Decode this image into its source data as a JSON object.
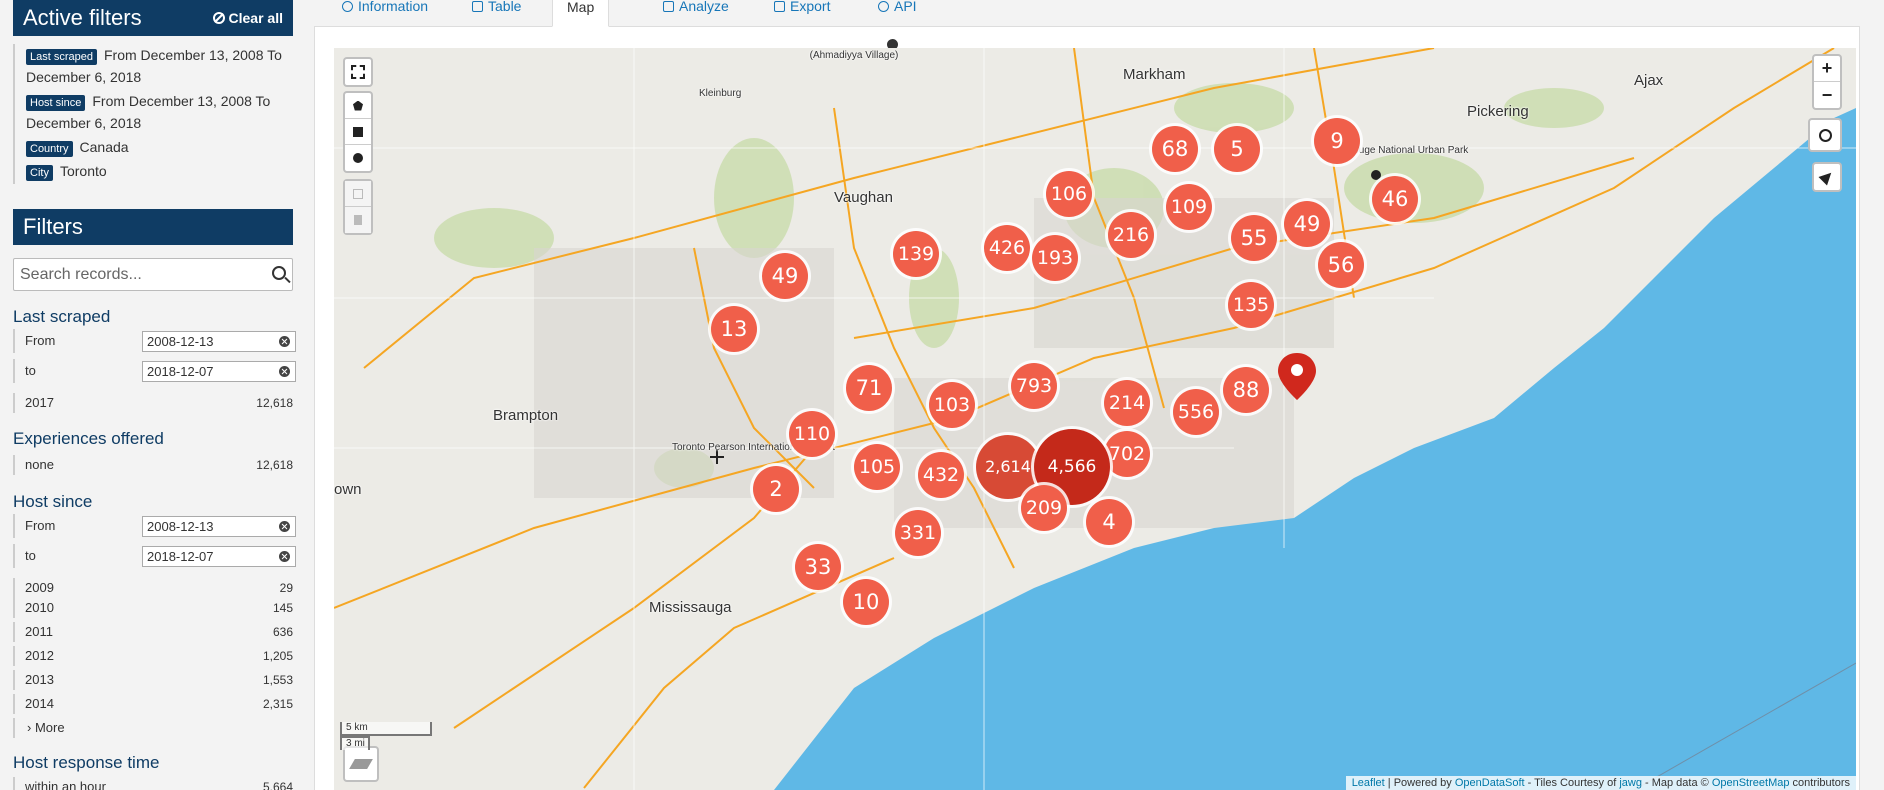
{
  "sidebar": {
    "active_filters": {
      "title": "Active filters",
      "clear_label": "Clear all",
      "items": [
        {
          "tag": "Last scraped",
          "text": "From December 13, 2008 To December 6, 2018"
        },
        {
          "tag": "Host since",
          "text": "From December 13, 2008 To December 6, 2018"
        },
        {
          "tag": "Country",
          "text": "Canada"
        },
        {
          "tag": "City",
          "text": "Toronto"
        }
      ]
    },
    "filters": {
      "title": "Filters",
      "search_placeholder": "Search records...",
      "last_scraped": {
        "title": "Last scraped",
        "from_label": "From",
        "from_value": "2008-12-13",
        "to_label": "to",
        "to_value": "2018-12-07",
        "rows": [
          {
            "label": "2017",
            "count": "12,618"
          }
        ]
      },
      "experiences": {
        "title": "Experiences offered",
        "rows": [
          {
            "label": "none",
            "count": "12,618"
          }
        ]
      },
      "host_since": {
        "title": "Host since",
        "from_label": "From",
        "from_value": "2008-12-13",
        "to_label": "to",
        "to_value": "2018-12-07",
        "rows": [
          {
            "label": "2009",
            "count": "29"
          },
          {
            "label": "2010",
            "count": "145"
          },
          {
            "label": "2011",
            "count": "636"
          },
          {
            "label": "2012",
            "count": "1,205"
          },
          {
            "label": "2013",
            "count": "1,553"
          },
          {
            "label": "2014",
            "count": "2,315"
          }
        ],
        "more_label": "› More"
      },
      "host_response_time": {
        "title": "Host response time",
        "rows": [
          {
            "label": "within an hour",
            "count": "5,664"
          }
        ]
      }
    }
  },
  "tabs": [
    {
      "label": "Information",
      "icon": "info-icon"
    },
    {
      "label": "Table",
      "icon": "table-icon"
    },
    {
      "label": "Map",
      "icon": "globe-icon",
      "active": true
    },
    {
      "label": "Analyze",
      "icon": "chart-icon"
    },
    {
      "label": "Export",
      "icon": "download-icon"
    },
    {
      "label": "API",
      "icon": "cogs-icon"
    }
  ],
  "map": {
    "places": [
      "Markham",
      "Ajax",
      "Pickering",
      "Vaughan",
      "Kleinburg",
      "(Ahmadiyya Village)",
      "Brampton",
      "Toronto Pearson International Airport",
      "Mississauga",
      "Rouge National Urban Park",
      "own",
      "O"
    ],
    "clusters": [
      "68",
      "5",
      "9",
      "106",
      "109",
      "46",
      "216",
      "55",
      "49",
      "139",
      "426",
      "193",
      "56",
      "49",
      "135",
      "13",
      "793",
      "214",
      "88",
      "71",
      "103",
      "556",
      "110",
      "702",
      "105",
      "432",
      "2,614",
      "4,566",
      "2",
      "209",
      "4",
      "331",
      "33",
      "10"
    ],
    "zoom_in": "+",
    "zoom_out": "−",
    "scale_km": "5 km",
    "scale_mi": "3 mi",
    "attribution": {
      "leaflet": "Leaflet",
      "powered": " | Powered by ",
      "ods": "OpenDataSoft",
      "tiles": " - Tiles Courtesy of ",
      "jawg": "jawg",
      "mapdata": " - Map data © ",
      "osm": "OpenStreetMap",
      "contrib": " contributors"
    },
    "colors": {
      "water": "#5fb8e6",
      "cluster": "#f05f4a",
      "cluster_large": "#c4291a",
      "road": "#f5a623",
      "header": "#0f3c64"
    }
  }
}
